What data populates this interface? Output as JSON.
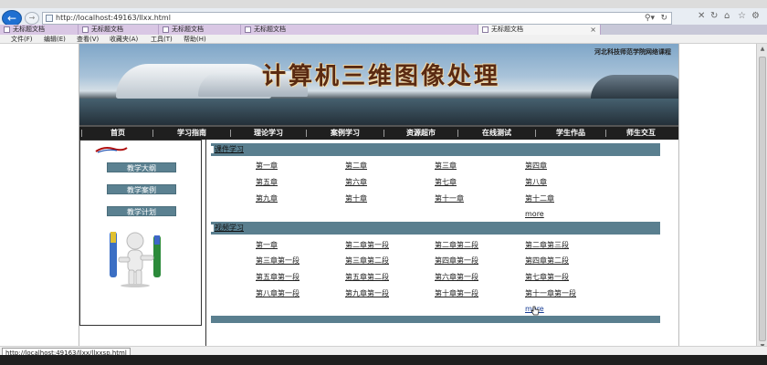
{
  "browser": {
    "url": "http://localhost:49163/llxx.html",
    "tabs": [
      {
        "label": "无标题文档",
        "active": false
      },
      {
        "label": "无标题文档",
        "active": false
      },
      {
        "label": "无标题文档",
        "active": false
      },
      {
        "label": "无标题文档",
        "active": false
      },
      {
        "label": "无标题文档",
        "active": true
      }
    ],
    "tab_close": "×",
    "menu": [
      "文件(F)",
      "编辑(E)",
      "查看(V)",
      "收藏夹(A)",
      "工具(T)",
      "帮助(H)"
    ],
    "status_url": "http://localhost:49163/llxx/llxxsp.html"
  },
  "site": {
    "banner_title": "计算机三维图像处理",
    "banner_school": "河北科技师范学院网络课程",
    "nav": [
      "首页",
      "学习指南",
      "理论学习",
      "案例学习",
      "资源超市",
      "在线测试",
      "学生作品",
      "师生交互"
    ],
    "sidebar_buttons": [
      "教学大纲",
      "教学案例",
      "教学计划"
    ]
  },
  "sections": [
    {
      "title": "课件学习",
      "links": [
        "第一章",
        "第二章",
        "第三章",
        "第四章",
        "第五章",
        "第六章",
        "第七章",
        "第八章",
        "第九章",
        "第十章",
        "第十一章",
        "第十二章"
      ],
      "more": "more"
    },
    {
      "title": "视频学习",
      "links": [
        "第一章",
        "第二章第一段",
        "第二章第二段",
        "第二章第三段",
        "第三章第一段",
        "第三章第二段",
        "第四章第一段",
        "第四章第二段",
        "第五章第一段",
        "第五章第二段",
        "第六章第一段",
        "第七章第一段",
        "第八章第一段",
        "第九章第一段",
        "第十章第一段",
        "第十一章第一段"
      ],
      "more": "more"
    }
  ],
  "colors": {
    "section_bar": "#5a7f8f",
    "nav_bg": "#1f1f1f",
    "sidebar_button": "#5b8191"
  }
}
